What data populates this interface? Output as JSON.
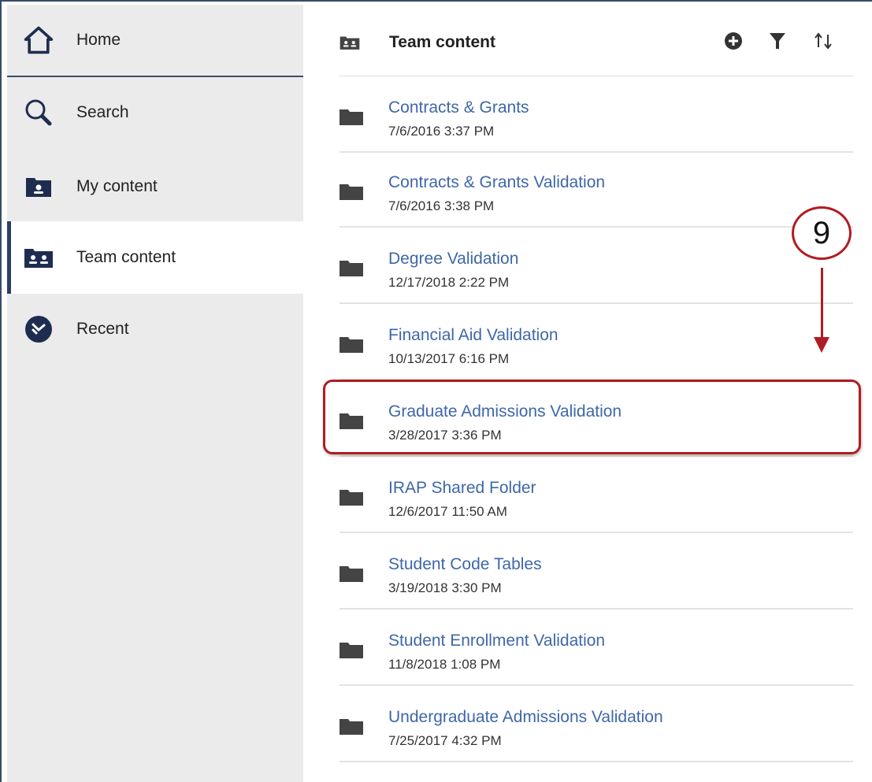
{
  "sidebar": {
    "items": [
      {
        "label": "Home",
        "icon": "home-icon"
      },
      {
        "label": "Search",
        "icon": "search-icon"
      },
      {
        "label": "My content",
        "icon": "my-content-icon"
      },
      {
        "label": "Team content",
        "icon": "team-content-icon"
      },
      {
        "label": "Recent",
        "icon": "recent-icon"
      }
    ],
    "selected": "Team content"
  },
  "header": {
    "title": "Team content",
    "tools": [
      "add-icon",
      "filter-icon",
      "sort-icon"
    ]
  },
  "folders": [
    {
      "name": "Contracts & Grants",
      "date": "7/6/2016 3:37 PM"
    },
    {
      "name": "Contracts & Grants Validation",
      "date": "7/6/2016 3:38 PM"
    },
    {
      "name": "Degree Validation",
      "date": "12/17/2018 2:22 PM"
    },
    {
      "name": "Financial Aid Validation",
      "date": "10/13/2017 6:16 PM"
    },
    {
      "name": "Graduate Admissions Validation",
      "date": "3/28/2017 3:36 PM"
    },
    {
      "name": "IRAP Shared Folder",
      "date": "12/6/2017 11:50 AM"
    },
    {
      "name": "Student Code Tables",
      "date": "3/19/2018 3:30 PM"
    },
    {
      "name": "Student Enrollment Validation",
      "date": "11/8/2018 1:08 PM"
    },
    {
      "name": "Undergraduate Admissions Validation",
      "date": "7/25/2017 4:32 PM"
    }
  ],
  "annotation": {
    "step": "9",
    "highlighted_folder": "Graduate Admissions Validation"
  },
  "colors": {
    "accent": "#2d3e66",
    "link": "#3f67a8",
    "annotation": "#b01c24",
    "sidebar_bg": "#ebebeb"
  }
}
